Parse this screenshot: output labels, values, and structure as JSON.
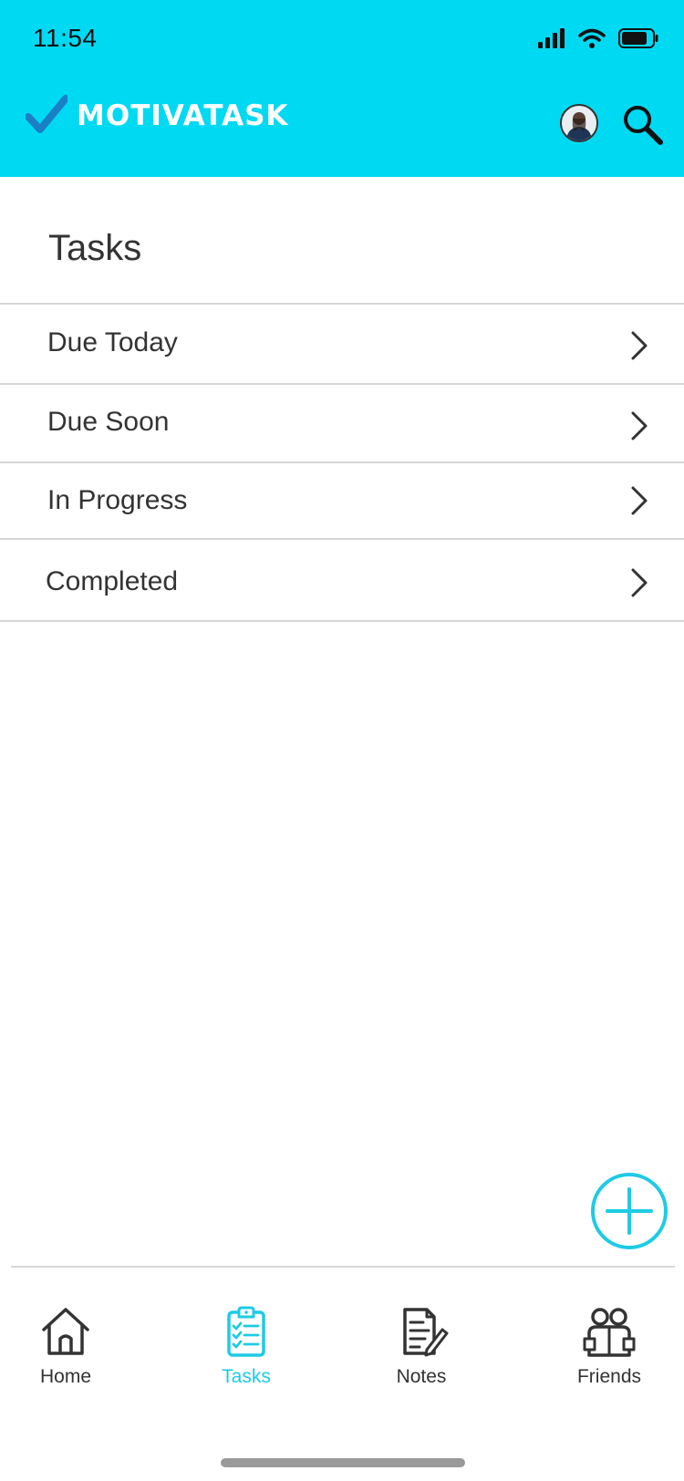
{
  "status_bar": {
    "time": "11:54"
  },
  "app": {
    "name": "MOTIVATASK"
  },
  "page": {
    "title": "Tasks"
  },
  "task_lists": [
    {
      "label": "Due Today"
    },
    {
      "label": "Due Soon"
    },
    {
      "label": "In Progress"
    },
    {
      "label": "Completed"
    }
  ],
  "tab_bar": {
    "active": "Tasks",
    "items": [
      {
        "label": "Home",
        "icon": "home-icon"
      },
      {
        "label": "Tasks",
        "icon": "clipboard-checklist-icon"
      },
      {
        "label": "Notes",
        "icon": "note-pencil-icon"
      },
      {
        "label": "Friends",
        "icon": "friends-icon"
      }
    ]
  },
  "colors": {
    "header_bg": "#00d9f2",
    "accent": "#1ecbe4",
    "check": "#1a7fc4",
    "text": "#333333"
  }
}
